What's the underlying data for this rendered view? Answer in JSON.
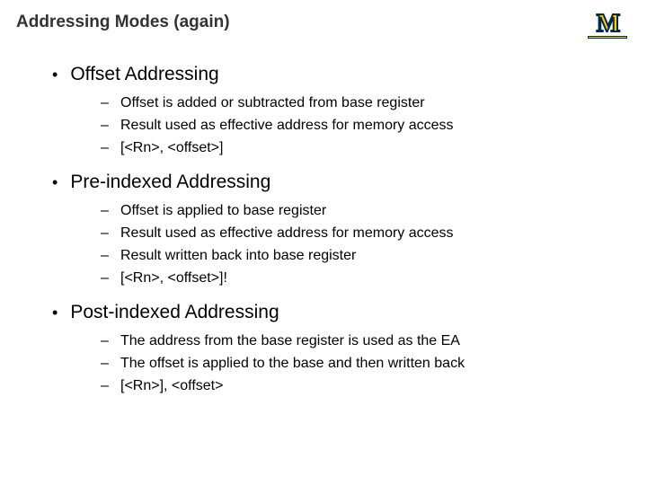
{
  "title": "Addressing Modes (again)",
  "logo": {
    "letter": "M"
  },
  "sections": [
    {
      "heading": "Offset Addressing",
      "items": [
        "Offset is added or subtracted from base register",
        "Result used as effective address for memory access",
        "[<Rn>, <offset>]"
      ]
    },
    {
      "heading": "Pre-indexed Addressing",
      "items": [
        "Offset is applied to base register",
        "Result used as effective address for memory access",
        "Result written back into base register",
        "[<Rn>, <offset>]!"
      ]
    },
    {
      "heading": "Post-indexed Addressing",
      "items": [
        "The address from the base register is used as the EA",
        "The offset is applied to the base and then written back",
        "[<Rn>], <offset>"
      ]
    }
  ]
}
